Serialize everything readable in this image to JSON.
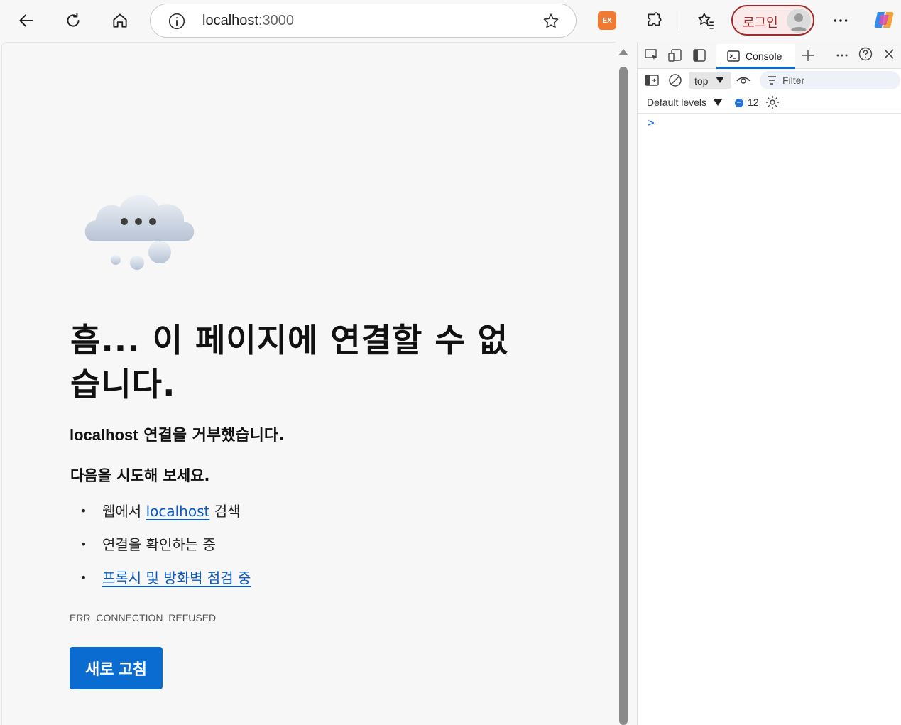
{
  "browser": {
    "url_host": "localhost",
    "url_port": ":3000",
    "ext_badge": "EX",
    "login_label": "로그인"
  },
  "page": {
    "headline": "흠... 이 페이지에 연결할 수 없습니다.",
    "subhead_host": "localhost",
    "subhead_rest": " 연결을 거부했습니다.",
    "try_label": "다음을 시도해 보세요.",
    "suggestions": {
      "s1_pre": "웹에서 ",
      "s1_link": "localhost",
      "s1_post": " 검색",
      "s2": "연결을 확인하는 중",
      "s3_link": "프록시 및 방화벽 점검 중"
    },
    "error_code": "ERR_CONNECTION_REFUSED",
    "reload_label": "새로 고침"
  },
  "devtools": {
    "tab_console": "Console",
    "context": "top",
    "filter_placeholder": "Filter",
    "levels": "Default levels",
    "message_count": "12",
    "prompt": ">"
  },
  "colors": {
    "accent": "#0a6bd0",
    "link": "#0a5bc4",
    "login_border": "#a02a2a",
    "ext_orange": "#f07a32"
  }
}
